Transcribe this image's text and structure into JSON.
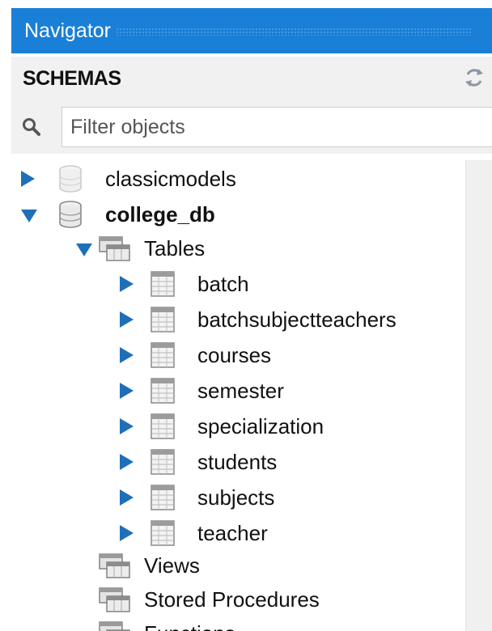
{
  "header": {
    "title": "Navigator"
  },
  "schemas": {
    "label": "SCHEMAS"
  },
  "filter": {
    "placeholder": "Filter objects",
    "value": ""
  },
  "tree": {
    "schemas": [
      {
        "name": "classicmodels",
        "expanded": false
      },
      {
        "name": "college_db",
        "expanded": true
      }
    ],
    "tables_folder": "Tables",
    "tables": [
      "batch",
      "batchsubjectteachers",
      "courses",
      "semester",
      "specialization",
      "students",
      "subjects",
      "teacher"
    ],
    "views_folder": "Views",
    "procedures_folder": "Stored Procedures",
    "functions_folder": "Functions"
  },
  "colors": {
    "header_bg": "#1a7fd6",
    "arrow": "#1f6fb8",
    "panel_bg": "#f1f1f1"
  }
}
